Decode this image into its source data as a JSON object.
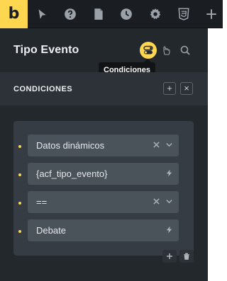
{
  "toolbar": {
    "logo_letter": "b",
    "icons": [
      "cursor-icon",
      "help-icon",
      "page-icon",
      "history-icon",
      "settings-icon",
      "html5-icon",
      "add-icon"
    ],
    "brand_color": "#ffd64f"
  },
  "header": {
    "title": "Tipo Evento",
    "icons": [
      "conditions-toggle-icon",
      "interactions-icon",
      "search-icon"
    ],
    "tooltip": "Condiciones"
  },
  "section": {
    "title": "CONDICIONES",
    "add_label": "+",
    "close_label": "×"
  },
  "conditions": [
    {
      "value": "Datos dinámicos",
      "trailing": [
        "clear-icon",
        "chevron-down-icon"
      ]
    },
    {
      "value": "{acf_tipo_evento}",
      "trailing": [
        "dynamic-data-icon"
      ]
    },
    {
      "value": "==",
      "trailing": [
        "clear-icon",
        "chevron-down-icon"
      ]
    },
    {
      "value": "Debate",
      "trailing": [
        "dynamic-data-icon"
      ]
    }
  ],
  "card_actions": [
    "add-icon",
    "trash-icon"
  ]
}
